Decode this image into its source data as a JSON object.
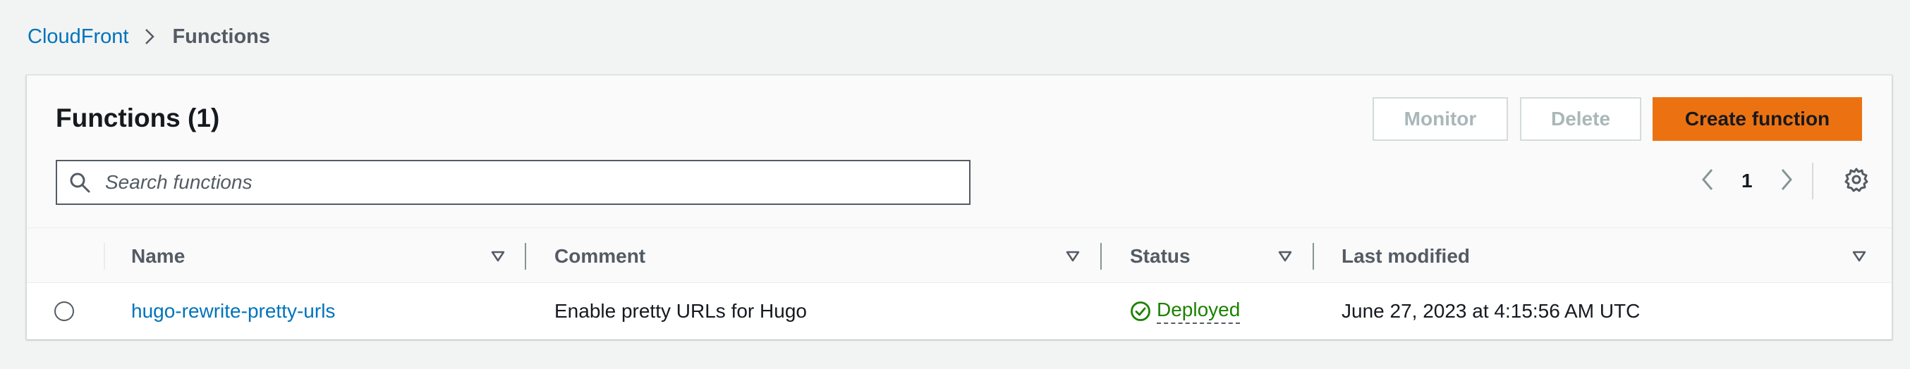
{
  "breadcrumb": {
    "root": "CloudFront",
    "current": "Functions"
  },
  "panel": {
    "title": "Functions (1)",
    "buttons": {
      "monitor": "Monitor",
      "delete": "Delete",
      "create": "Create function"
    },
    "search": {
      "placeholder": "Search functions",
      "value": ""
    },
    "pagination": {
      "current_page": "1"
    }
  },
  "table": {
    "columns": [
      "Name",
      "Comment",
      "Status",
      "Last modified"
    ],
    "rows": [
      {
        "name": "hugo-rewrite-pretty-urls",
        "comment": "Enable pretty URLs for Hugo",
        "status": "Deployed",
        "last_modified": "June 27, 2023 at 4:15:56 AM UTC"
      }
    ]
  },
  "colors": {
    "link": "#0073bb",
    "primary_button": "#ec7211",
    "status_success": "#1d8102",
    "page_background": "#f2f3f3"
  },
  "icons": {
    "breadcrumb_separator": "chevron-right-icon",
    "search": "search-icon",
    "prev": "chevron-left-icon",
    "next": "chevron-right-icon",
    "settings": "gear-icon",
    "sort": "caret-down-outline-icon",
    "status": "check-circle-icon"
  }
}
